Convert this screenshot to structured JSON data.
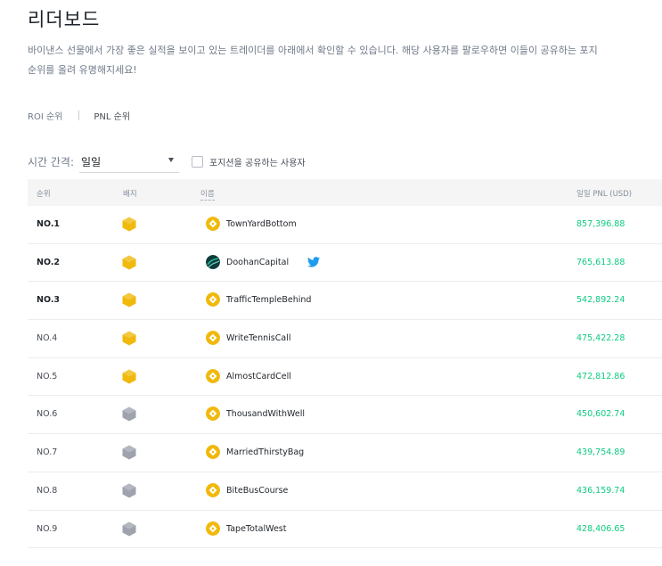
{
  "page": {
    "title": "리더보드",
    "description_line1": "바이낸스 선물에서 가장 좋은 실적을 보이고 있는 트레이더를 아래에서 확인할 수 있습니다. 해당 사용자를 팔로우하면 이들이 공유하는 포지",
    "description_line2": "순위를 올려 유명해지세요!"
  },
  "tabs": [
    "ROI 순위",
    "PNL 순위"
  ],
  "active_tab": "PNL 순위",
  "filters": {
    "period_label": "시간 간격:",
    "period_value": "일일",
    "share_checkbox_label": "포지션을 공유하는 사용자",
    "share_checked": false
  },
  "table": {
    "headers": {
      "rank": "순위",
      "badge": "배지",
      "name": "이름",
      "pnl": "일일 PNL (USD)"
    },
    "rows": [
      {
        "rank": "NO.1",
        "badge": "gold",
        "avatar": "binance-logo",
        "name": "TownYardBottom",
        "twitter": false,
        "pnl": "857,396.88"
      },
      {
        "rank": "NO.2",
        "badge": "gold",
        "avatar": "custom-avatar",
        "name": "DoohanCapital",
        "twitter": true,
        "pnl": "765,613.88"
      },
      {
        "rank": "NO.3",
        "badge": "gold",
        "avatar": "binance-logo",
        "name": "TrafficTempleBehind",
        "twitter": false,
        "pnl": "542,892.24"
      },
      {
        "rank": "NO.4",
        "badge": "gold",
        "avatar": "binance-logo",
        "name": "WriteTennisCall",
        "twitter": false,
        "pnl": "475,422.28"
      },
      {
        "rank": "NO.5",
        "badge": "gold",
        "avatar": "binance-logo",
        "name": "AlmostCardCell",
        "twitter": false,
        "pnl": "472,812.86"
      },
      {
        "rank": "NO.6",
        "badge": "silver",
        "avatar": "binance-logo",
        "name": "ThousandWithWell",
        "twitter": false,
        "pnl": "450,602.74"
      },
      {
        "rank": "NO.7",
        "badge": "silver",
        "avatar": "binance-logo",
        "name": "MarriedThirstyBag",
        "twitter": false,
        "pnl": "439,754.89"
      },
      {
        "rank": "NO.8",
        "badge": "silver",
        "avatar": "binance-logo",
        "name": "BiteBusCourse",
        "twitter": false,
        "pnl": "436,159.74"
      },
      {
        "rank": "NO.9",
        "badge": "silver",
        "avatar": "binance-logo",
        "name": "TapeTotalWest",
        "twitter": false,
        "pnl": "428,406.65"
      }
    ]
  },
  "colors": {
    "gold": "#f0b90b",
    "silver": "#9ea3ad",
    "pnl_positive": "#0ecb81",
    "twitter": "#1d9bf0"
  }
}
